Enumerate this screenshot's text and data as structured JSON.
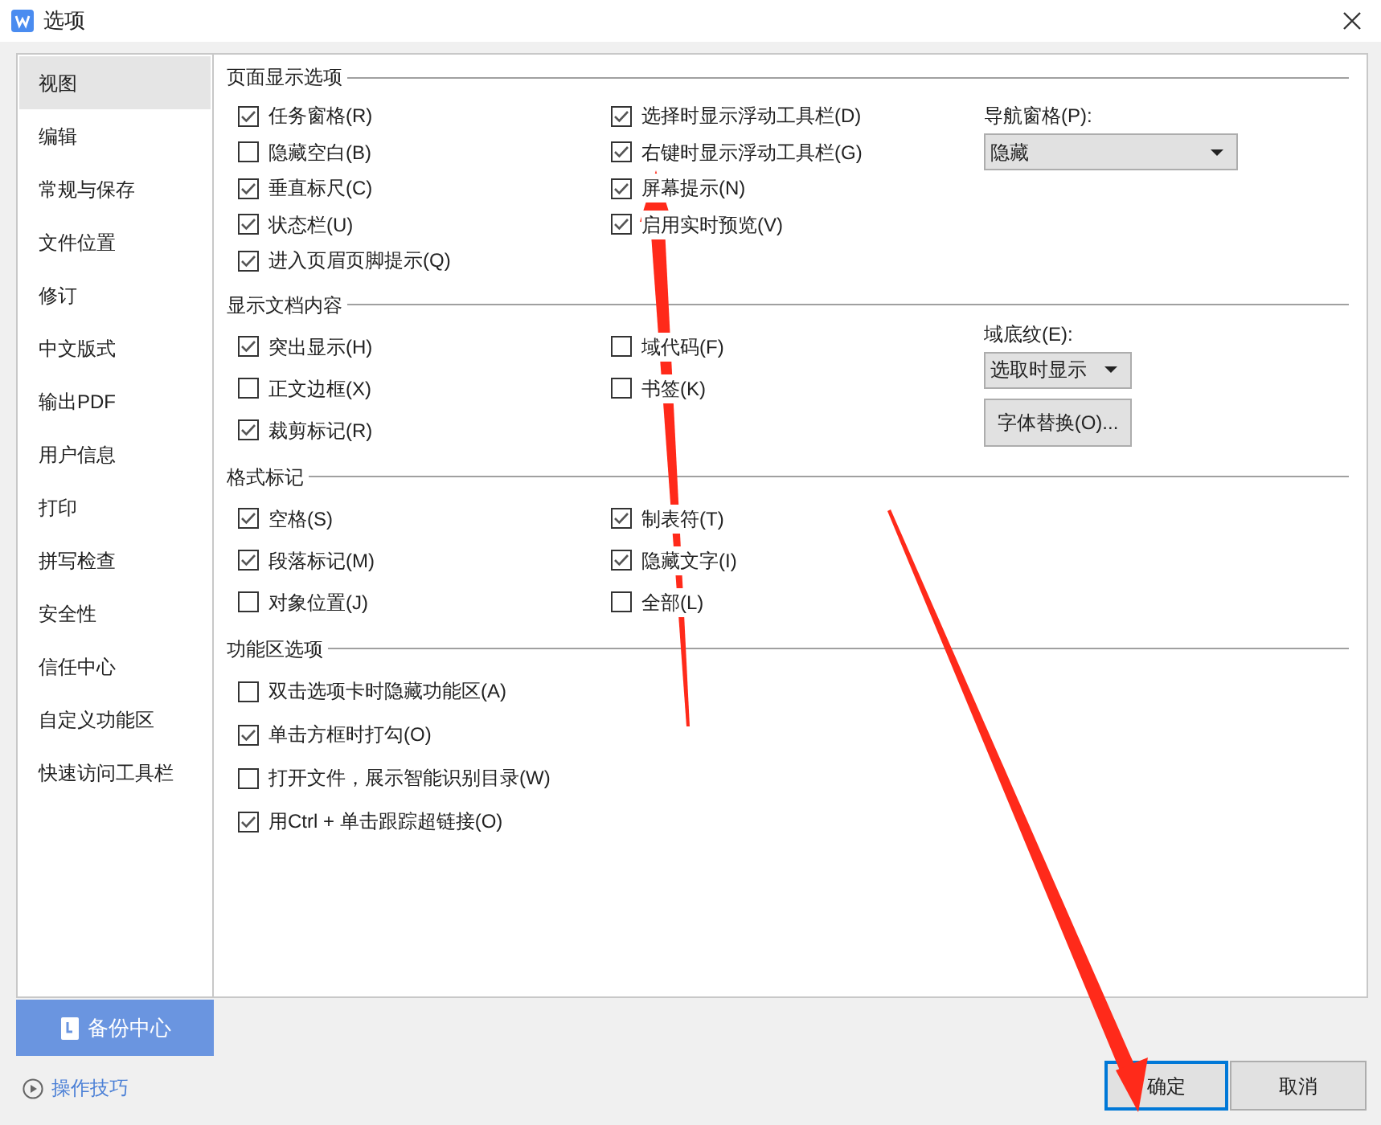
{
  "window": {
    "title": "选项"
  },
  "sidebar": {
    "items": [
      {
        "label": "视图",
        "selected": true
      },
      {
        "label": "编辑",
        "selected": false
      },
      {
        "label": "常规与保存",
        "selected": false
      },
      {
        "label": "文件位置",
        "selected": false
      },
      {
        "label": "修订",
        "selected": false
      },
      {
        "label": "中文版式",
        "selected": false
      },
      {
        "label": "输出PDF",
        "selected": false
      },
      {
        "label": "用户信息",
        "selected": false
      },
      {
        "label": "打印",
        "selected": false
      },
      {
        "label": "拼写检查",
        "selected": false
      },
      {
        "label": "安全性",
        "selected": false
      },
      {
        "label": "信任中心",
        "selected": false
      },
      {
        "label": "自定义功能区",
        "selected": false
      },
      {
        "label": "快速访问工具栏",
        "selected": false
      }
    ]
  },
  "backup_button": {
    "label": "备份中心"
  },
  "tips_link": {
    "label": "操作技巧"
  },
  "sections": [
    {
      "title": "页面显示选项",
      "columns": [
        [
          {
            "label": "任务窗格(R)",
            "checked": true
          },
          {
            "label": "隐藏空白(B)",
            "checked": false
          },
          {
            "label": "垂直标尺(C)",
            "checked": true
          },
          {
            "label": "状态栏(U)",
            "checked": true
          },
          {
            "label": "进入页眉页脚提示(Q)",
            "checked": true
          }
        ],
        [
          {
            "label": "选择时显示浮动工具栏(D)",
            "checked": true
          },
          {
            "label": "右键时显示浮动工具栏(G)",
            "checked": true
          },
          {
            "label": "屏幕提示(N)",
            "checked": true
          },
          {
            "label": "启用实时预览(V)",
            "checked": true
          }
        ]
      ],
      "side": [
        {
          "kind": "dropdown",
          "label": "导航窗格(P):",
          "value": "隐藏"
        }
      ]
    },
    {
      "title": "显示文档内容",
      "columns": [
        [
          {
            "label": "突出显示(H)",
            "checked": true
          },
          {
            "label": "正文边框(X)",
            "checked": false
          },
          {
            "label": "裁剪标记(R)",
            "checked": true
          }
        ],
        [
          {
            "label": "域代码(F)",
            "checked": false
          },
          {
            "label": "书签(K)",
            "checked": false
          }
        ]
      ],
      "side": [
        {
          "kind": "dropdown",
          "label": "域底纹(E):",
          "value": "选取时显示"
        },
        {
          "kind": "button",
          "label": "字体替换(O)..."
        }
      ]
    },
    {
      "title": "格式标记",
      "columns": [
        [
          {
            "label": "空格(S)",
            "checked": true
          },
          {
            "label": "段落标记(M)",
            "checked": true
          },
          {
            "label": "对象位置(J)",
            "checked": false
          }
        ],
        [
          {
            "label": "制表符(T)",
            "checked": true
          },
          {
            "label": "隐藏文字(I)",
            "checked": true
          },
          {
            "label": "全部(L)",
            "checked": false
          }
        ]
      ]
    },
    {
      "title": "功能区选项",
      "columns": [
        [
          {
            "label": "双击选项卡时隐藏功能区(A)",
            "checked": false
          },
          {
            "label": "单击方框时打勾(O)",
            "checked": true
          },
          {
            "label": "打开文件，展示智能识别目录(W)",
            "checked": false
          },
          {
            "label": "用Ctrl + 单击跟踪超链接(O)",
            "checked": true
          }
        ]
      ]
    }
  ],
  "buttons": [
    {
      "label": "确定",
      "selected": true
    },
    {
      "label": "取消",
      "selected": false
    }
  ]
}
